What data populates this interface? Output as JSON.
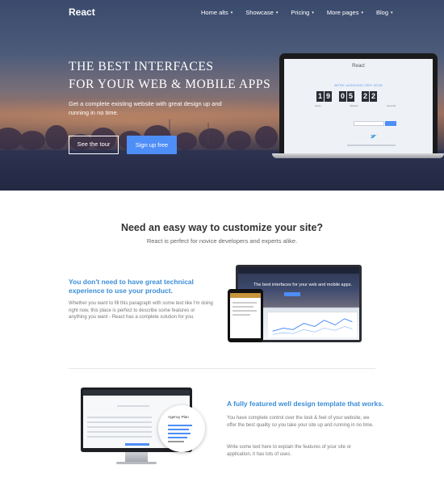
{
  "nav": {
    "brand": "React",
    "items": [
      {
        "label": "Home alts"
      },
      {
        "label": "Showcase"
      },
      {
        "label": "Pricing"
      },
      {
        "label": "More pages"
      },
      {
        "label": "Blog"
      }
    ],
    "caret": "▾"
  },
  "hero": {
    "title_line1": "THE BEST INTERFACES",
    "title_line2": "FOR YOUR WEB & MOBILE APPS",
    "subtitle": "Get a complete existing website with great design up and running in no time.",
    "tour_button": "See the tour",
    "signup_button": "Sign up free"
  },
  "laptop_screen": {
    "brand": "React",
    "tagline": "WE'RE LAUNCHING VERY SOON",
    "digits": [
      "1",
      "9",
      "0",
      "5",
      "2",
      "2"
    ],
    "units": [
      "Hours",
      "Minutes",
      "Seconds"
    ],
    "twitter_glyph": "♥"
  },
  "section": {
    "title": "Need an easy way to customize your site?",
    "subtitle": "React is perfect for novice developers and experts alike."
  },
  "feature1": {
    "title": "You don't need to have great technical experience to use your product.",
    "body": "Whether you want to fill this paragraph with some text like I'm doing right now, this place is perfect to describe some features or anything you want - React has a complete solution for you."
  },
  "showcase1": {
    "headline": "The best interfaces for your web and mobile apps."
  },
  "feature2": {
    "title": "A fully featured well design template that works.",
    "body1": "You have complete control over the look & feel of your website, we offer the best quality so you take your site up and running in no time.",
    "body2": "Write some text here to explain the features of your site or application, it has lots of uses."
  },
  "showcase2": {
    "circle_title": "Agency Plan"
  },
  "colors": {
    "accent": "#4e8ef7",
    "link": "#3b8dd8"
  }
}
